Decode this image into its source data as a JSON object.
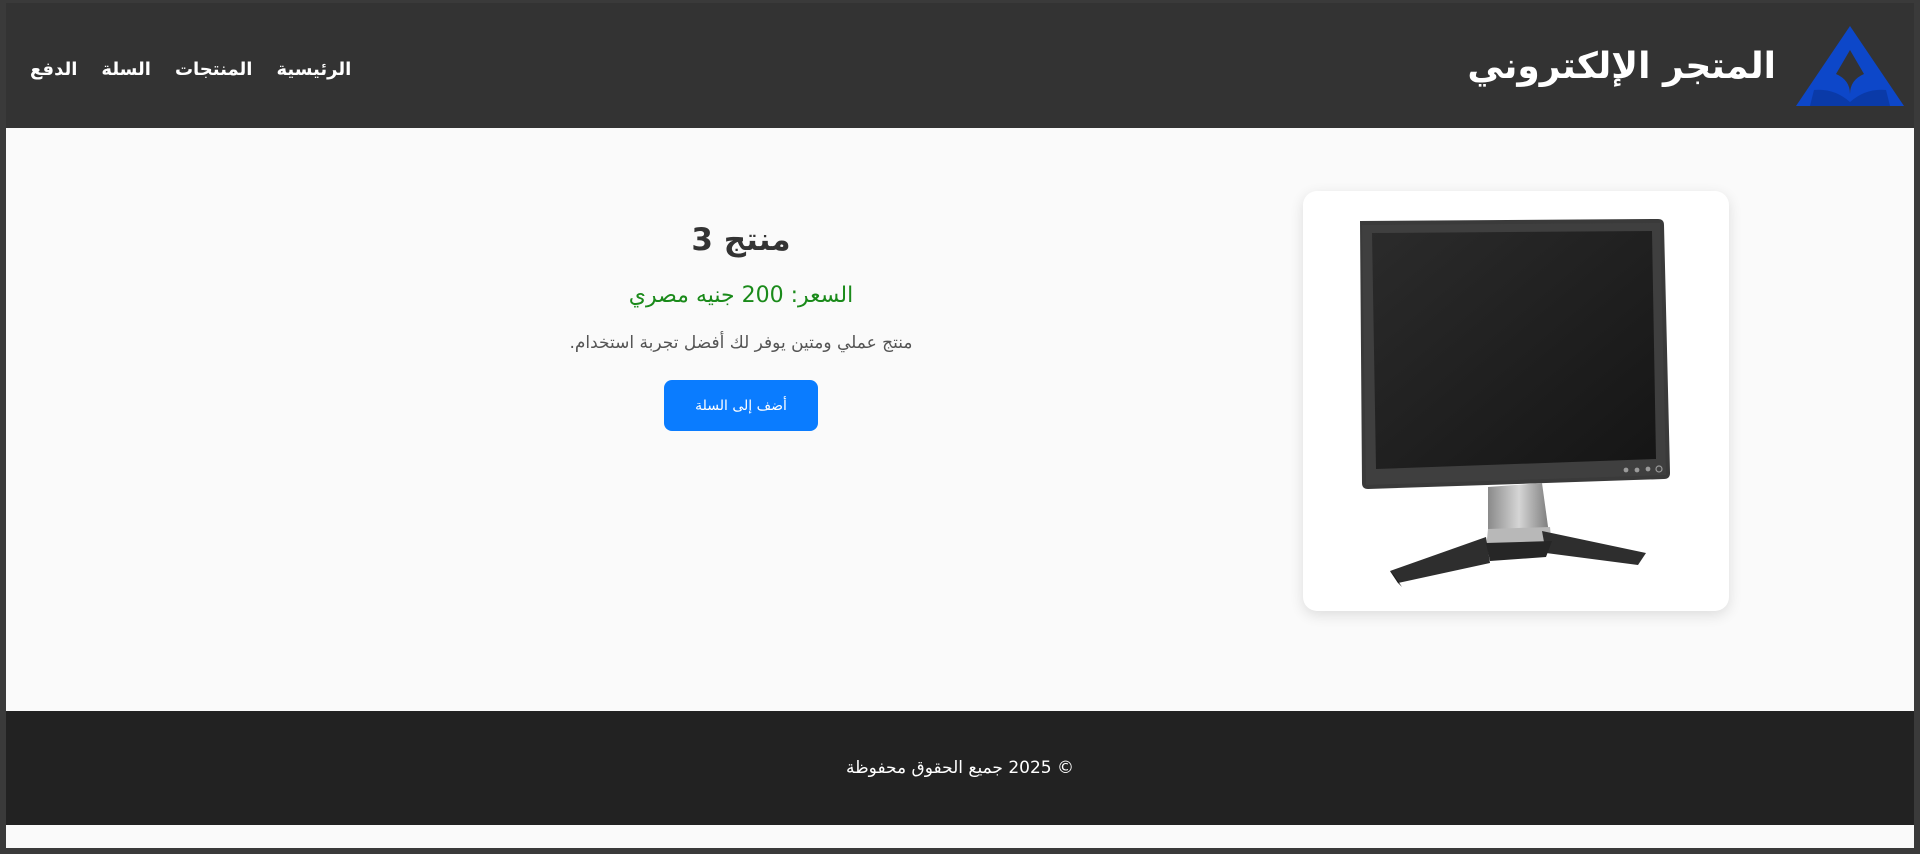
{
  "header": {
    "brand_title": "المتجر الإلكتروني",
    "logo_icon": "blue-triangle-logo-icon",
    "nav": [
      {
        "label": "الرئيسية"
      },
      {
        "label": "المنتجات"
      },
      {
        "label": "السلة"
      },
      {
        "label": "الدفع"
      }
    ]
  },
  "product": {
    "name": "منتج 3",
    "price": "السعر: 200 جنيه مصري",
    "description": "منتج عملي ومتين يوفر لك أفضل تجربة استخدام.",
    "add_to_cart_label": "أضف إلى السلة",
    "image": "computer-monitor-image"
  },
  "footer": {
    "copyright": "© 2025 جميع الحقوق محفوظة"
  },
  "colors": {
    "header_bg": "#333333",
    "footer_bg": "#222222",
    "accent": "#0a7cff",
    "price": "#1a8a1a",
    "logo": "#0d47c9"
  }
}
